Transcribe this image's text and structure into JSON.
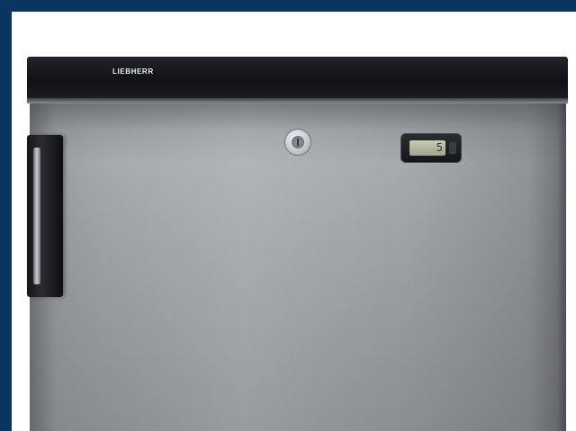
{
  "scene": {
    "description_alt": "",
    "brand_text": "LIEBHERR",
    "display_value": "5",
    "colors": {
      "frame_border": "#0b3460",
      "fridge_top": "#15171a",
      "door_steel": "#9ea2a6",
      "handle": "#1c1d20",
      "display_lcd": "#b3b8a2"
    }
  }
}
